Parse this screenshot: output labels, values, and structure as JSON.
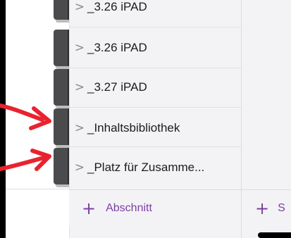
{
  "sections": [
    {
      "label": "_3.26 iPAD",
      "partial": true
    },
    {
      "label": "_3.26 iPAD"
    },
    {
      "label": "_3.27 iPAD"
    },
    {
      "label": "_Inhaltsbibliothek"
    },
    {
      "label": "_Platz für Zusamme..."
    }
  ],
  "chevron": ">",
  "add_section_label": "Abschnitt",
  "add_page_label": "S",
  "accent_color": "#7b3fa4",
  "annotation_color": "#e8232f",
  "icons": {
    "plus": "+",
    "arrow": "red-arrow-icon"
  }
}
